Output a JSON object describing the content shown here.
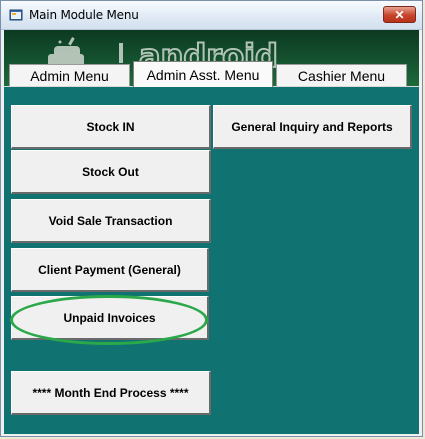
{
  "window": {
    "title": "Main Module Menu",
    "close_label": "✕"
  },
  "banner": {
    "logo_text": "android"
  },
  "tabs": [
    {
      "label": "Admin Menu",
      "active": false
    },
    {
      "label": "Admin Asst. Menu",
      "active": true
    },
    {
      "label": "Cashier Menu",
      "active": false
    }
  ],
  "buttons": {
    "stock_in": "Stock IN",
    "stock_out": "Stock Out",
    "void_sale": "Void Sale Transaction",
    "client_payment": "Client Payment (General)",
    "unpaid_invoices": "Unpaid Invoices",
    "month_end": "**** Month End Process ****",
    "general_inquiry": "General Inquiry and Reports"
  },
  "colors": {
    "panel_background": "#107372",
    "highlight_ellipse": "#2aa84a",
    "banner_green": "#14502e"
  },
  "icons": {
    "app_icon": "window-app-icon",
    "close_icon": "close-icon",
    "android_logo": "android-robot-icon"
  }
}
